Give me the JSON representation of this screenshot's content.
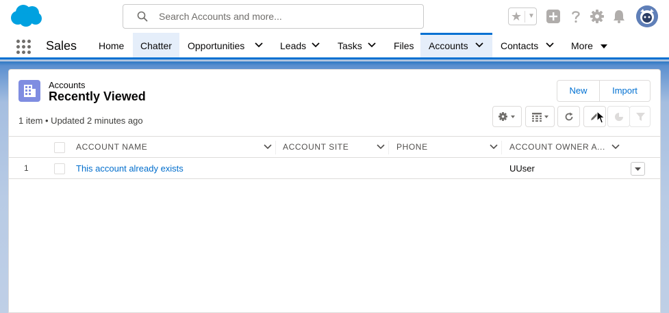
{
  "header": {
    "search_placeholder": "Search Accounts and more..."
  },
  "nav": {
    "app_name": "Sales",
    "tabs": [
      {
        "label": "Home",
        "has_menu": false
      },
      {
        "label": "Chatter",
        "has_menu": false
      },
      {
        "label": "Opportunities",
        "has_menu": true
      },
      {
        "label": "Leads",
        "has_menu": true
      },
      {
        "label": "Tasks",
        "has_menu": true
      },
      {
        "label": "Files",
        "has_menu": false
      },
      {
        "label": "Accounts",
        "has_menu": true,
        "active": true
      },
      {
        "label": "Contacts",
        "has_menu": true
      },
      {
        "label": "More",
        "has_menu": true
      }
    ]
  },
  "list_view": {
    "object_label": "Accounts",
    "view_name": "Recently Viewed",
    "meta": "1 item • Updated 2 minutes ago",
    "buttons": {
      "new": "New",
      "import": "Import"
    },
    "columns": [
      "ACCOUNT NAME",
      "ACCOUNT SITE",
      "PHONE",
      "ACCOUNT OWNER A..."
    ],
    "rows": [
      {
        "num": "1",
        "account_name": "This account already exists",
        "account_site": "",
        "phone": "",
        "owner": "UUser"
      }
    ]
  },
  "colors": {
    "brand_blue": "#0070d2",
    "link_blue": "#006dcc",
    "object_icon": "#7f8de1",
    "active_tab_bg": "#e5eefa"
  },
  "icons": [
    "salesforce-cloud-icon",
    "search-icon",
    "star-icon",
    "plus-icon",
    "help-icon",
    "gear-icon",
    "bell-icon",
    "app-launcher-icon",
    "account-object-icon",
    "list-settings-icon",
    "table-view-icon",
    "refresh-icon",
    "edit-pencil-icon",
    "chart-icon",
    "filter-icon"
  ]
}
